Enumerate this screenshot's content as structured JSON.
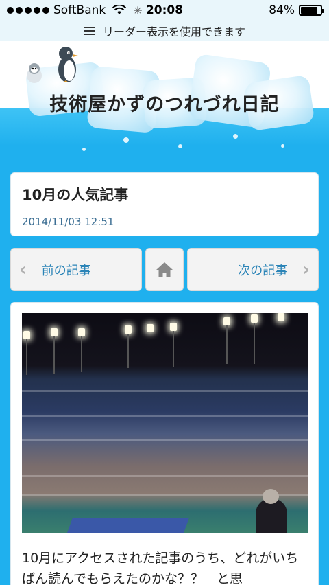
{
  "status_bar": {
    "carrier": "SoftBank",
    "time": "20:08",
    "battery": "84%",
    "battery_level": 0.84
  },
  "reader_bar": {
    "label": "リーダー表示を使用できます"
  },
  "header": {
    "site_title": "技術屋かずのつれづれ日記"
  },
  "article": {
    "title": "10月の人気記事",
    "date": "2014/11/03 12:51",
    "body": "10月にアクセスされた記事のうち、どれがいちばん読んでもらえたのかな？？　と思"
  },
  "nav": {
    "prev_label": "前の記事",
    "next_label": "次の記事",
    "prev_icon": "chevron-left-icon",
    "next_icon": "chevron-right-icon",
    "home_icon": "home-icon"
  },
  "colors": {
    "accent": "#2b84b7",
    "background": "#1fb0ee"
  }
}
